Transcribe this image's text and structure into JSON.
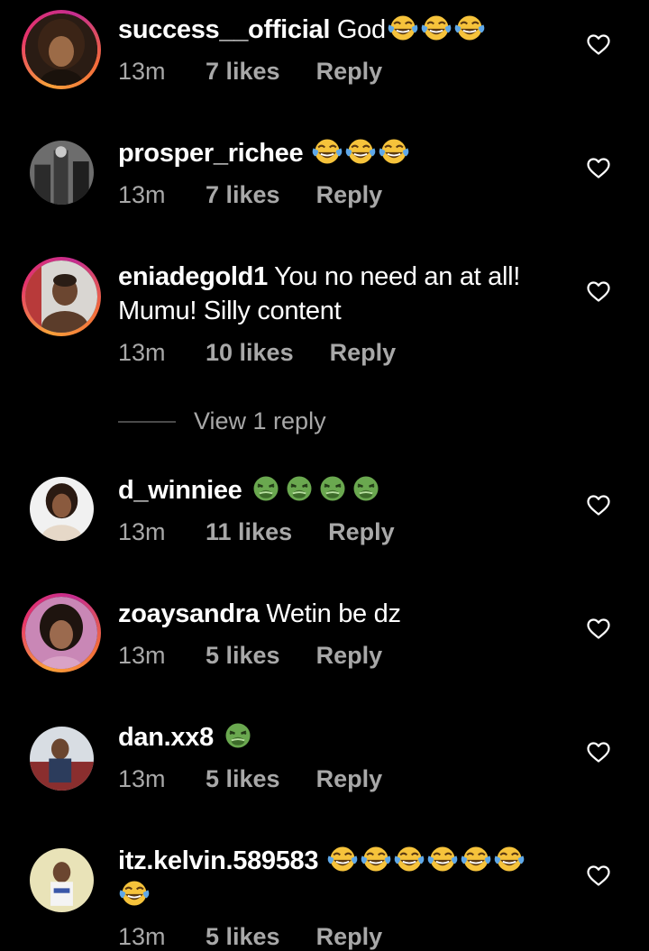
{
  "colors": {
    "background": "#000000",
    "text": "#ffffff",
    "muted": "#a8a8a8",
    "story_ring": "#e6336b"
  },
  "icons": {
    "laugh": "face-with-tears-of-joy-icon",
    "nauseated": "nauseated-face-icon",
    "like": "heart-outline-icon"
  },
  "comments": [
    {
      "username": "success__official",
      "text": "God",
      "emoji": [
        "laugh",
        "laugh",
        "laugh"
      ],
      "time": "13m",
      "likes": "7 likes",
      "reply": "Reply",
      "story": true
    },
    {
      "username": "prosper_richee",
      "text": "",
      "emoji": [
        "laugh",
        "laugh",
        "laugh"
      ],
      "time": "13m",
      "likes": "7 likes",
      "reply": "Reply",
      "story": false
    },
    {
      "username": "eniadegold1",
      "text": "You no need an at all!",
      "text2": "Mumu! Silly content",
      "time": "13m",
      "likes": "10 likes",
      "reply": "Reply",
      "story": true
    },
    {
      "username": "d_winniee",
      "text": "",
      "emoji": [
        "nauseated",
        "nauseated",
        "nauseated",
        "nauseated"
      ],
      "time": "13m",
      "likes": "11 likes",
      "reply": "Reply",
      "story": false
    },
    {
      "username": "zoaysandra",
      "text": "Wetin be dz",
      "time": "13m",
      "likes": "5 likes",
      "reply": "Reply",
      "story": true
    },
    {
      "username": "dan.xx8",
      "text": "",
      "emoji": [
        "nauseated"
      ],
      "time": "13m",
      "likes": "5 likes",
      "reply": "Reply",
      "story": false
    },
    {
      "username": "itz.kelvin.589583",
      "text": "",
      "emoji": [
        "laugh",
        "laugh",
        "laugh",
        "laugh",
        "laugh",
        "laugh"
      ],
      "emoji2": [
        "laugh"
      ],
      "time": "13m",
      "likes": "5 likes",
      "reply": "Reply",
      "story": false
    }
  ],
  "view_replies": "View 1 reply"
}
